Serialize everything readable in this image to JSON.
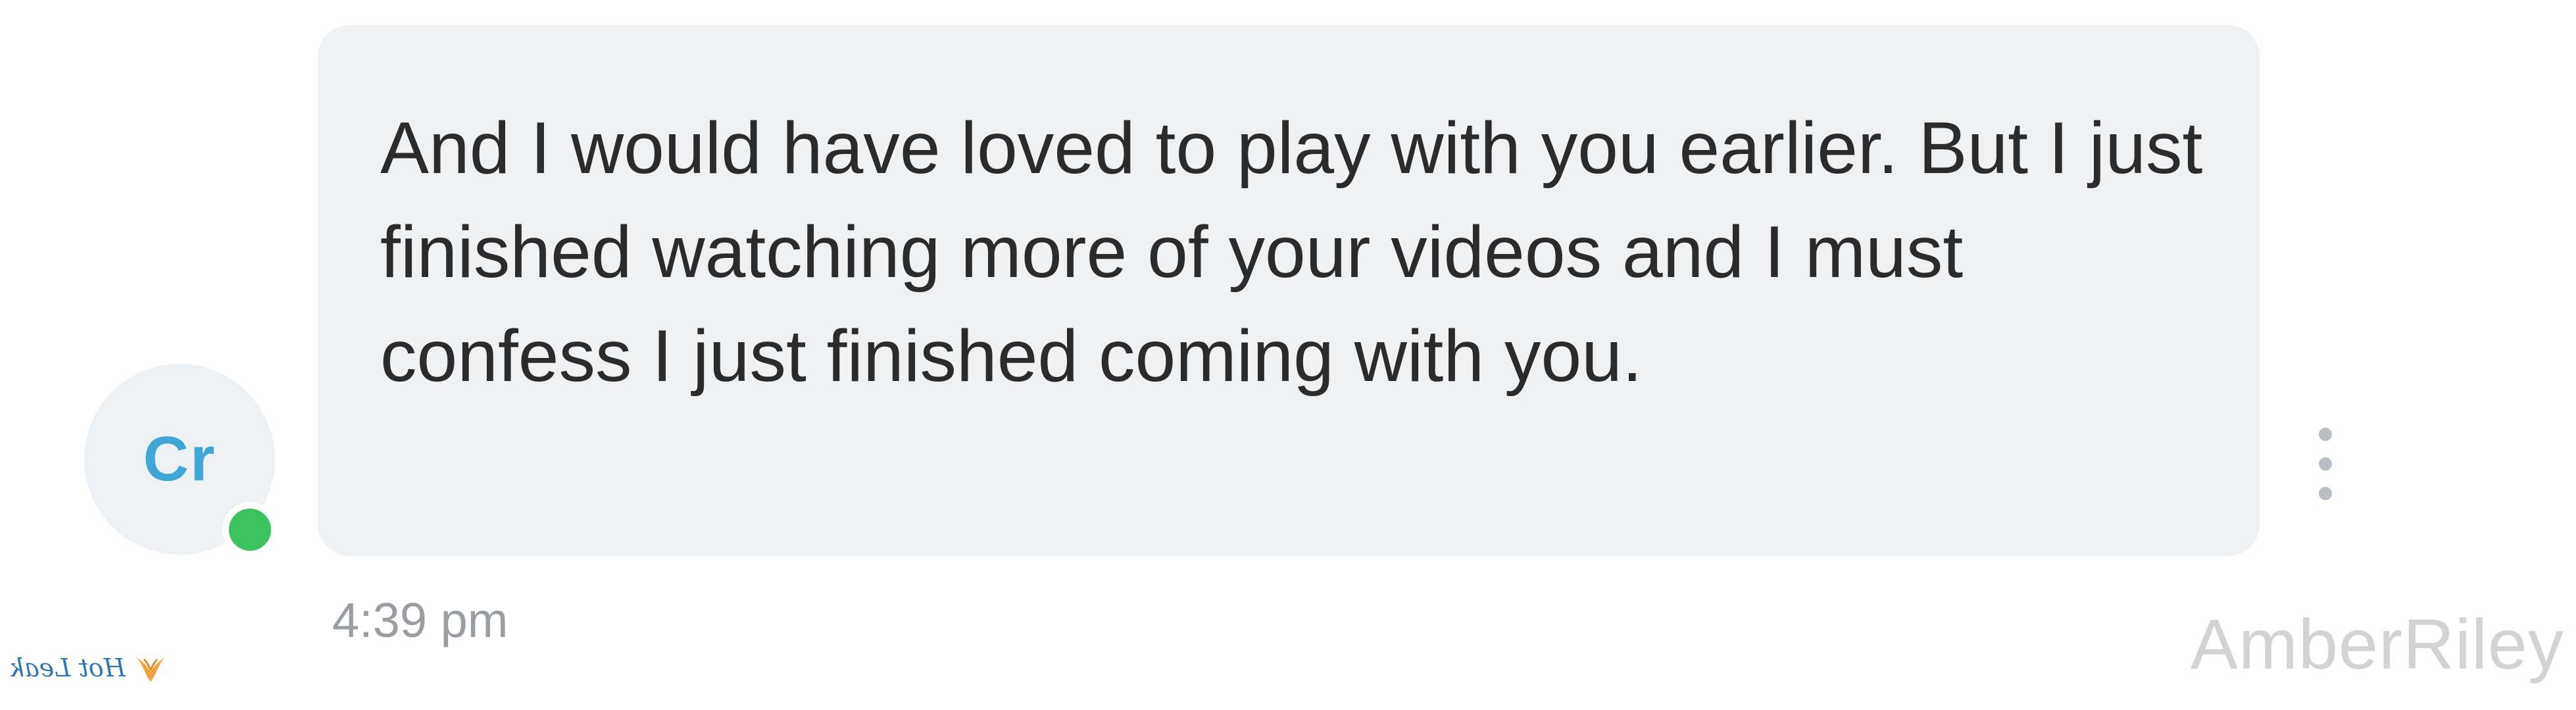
{
  "conversation": {
    "contact": {
      "initials": "Cr",
      "online": true,
      "status_color": "#3ac35e",
      "initials_color": "#3fa7d6"
    },
    "message": {
      "text": "And I would have loved to play with you earlier. But I just finished watching more of your videos and I must confess I just finished coming with you.",
      "timestamp": "4:39 pm",
      "bubble_color": "#eff1f3",
      "menu_icon": "more-vertical-icon"
    }
  },
  "watermarks": {
    "username": "AmberRiley",
    "logo_text": "Hot Leak",
    "logo_icon": "hotleak-logo-icon"
  }
}
